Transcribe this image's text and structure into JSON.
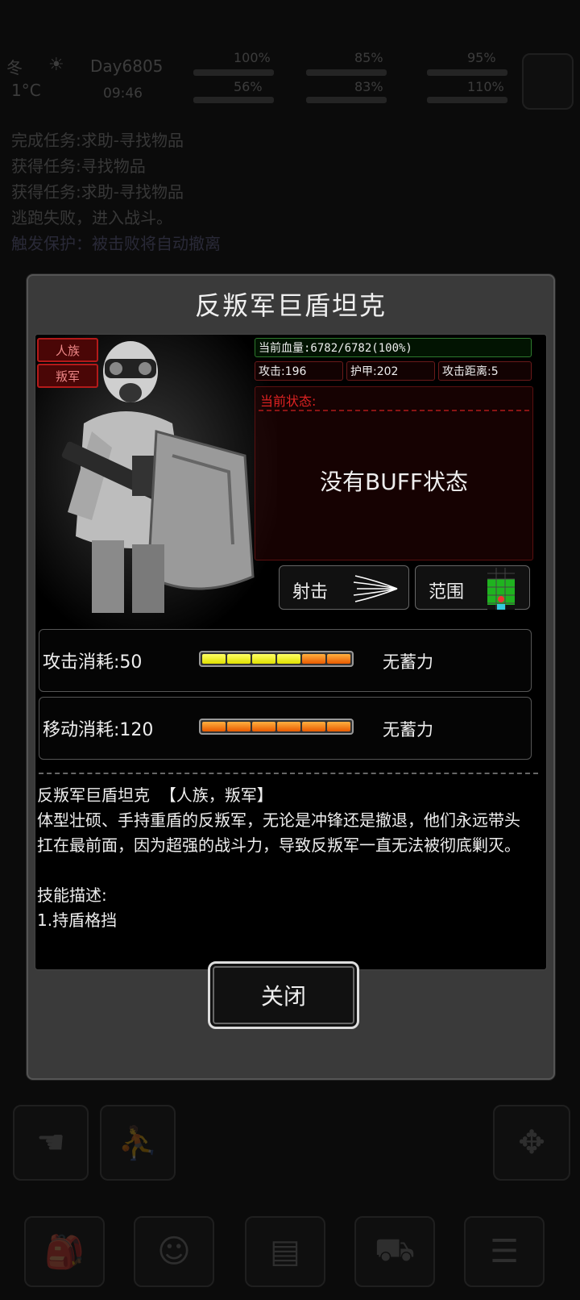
{
  "hud": {
    "season": "冬",
    "temperature": "1°C",
    "day": "Day6805",
    "time": "09:46",
    "stat1": "100%",
    "stat2": "56%",
    "stat3": "85%",
    "stat4": "83%",
    "stat5": "95%",
    "stat6": "110%"
  },
  "log": [
    "完成任务:求助-寻找物品",
    "获得任务:寻找物品",
    "获得任务:求助-寻找物品",
    "逃跑失败，进入战斗。",
    "触发保护：被击败将自动撤离"
  ],
  "modal": {
    "title": "反叛军巨盾坦克",
    "tags": [
      "人族",
      "叛军"
    ],
    "hp": "当前血量:6782/6782(100%)",
    "attack": "攻击:196",
    "armor": "护甲:202",
    "range": "攻击距离:5",
    "state_label": "当前状态:",
    "state_text": "没有BUFF状态",
    "skills": [
      {
        "label": "射击",
        "icon": "shoot-icon"
      },
      {
        "label": "范围",
        "icon": "range-grid-icon"
      }
    ],
    "costs": [
      {
        "label": "攻击消耗:50",
        "filled_yellow": 4,
        "filled_orange": 2,
        "status": "无蓄力"
      },
      {
        "label": "移动消耗:120",
        "filled_yellow": 0,
        "filled_orange": 6,
        "status": "无蓄力"
      }
    ],
    "desc_title": "反叛军巨盾坦克  【人族，叛军】",
    "desc_body": "体型壮硕、手持重盾的反叛军，无论是冲锋还是撤退，他们永远带头扛在最前面，因为超强的战斗力，导致反叛军一直无法被彻底剿灭。",
    "skill_desc_title": "技能描述:",
    "skill_desc_first": "1.持盾格挡",
    "close": "关闭"
  },
  "colors": {
    "modal_bg": "#3a3a3a",
    "tag_red": "#b31a1a",
    "hp_green": "#2d7a2d",
    "bar_yellow": "#f0f000",
    "bar_orange": "#f07000"
  }
}
